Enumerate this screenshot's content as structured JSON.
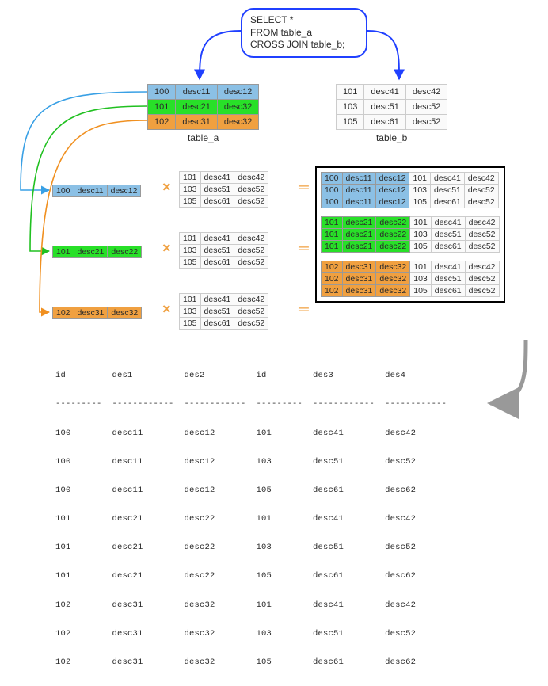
{
  "sql": {
    "line1": "SELECT *",
    "line2": "FROM table_a",
    "line3": "CROSS JOIN table_b;"
  },
  "table_a": {
    "caption": "table_a",
    "rows": [
      [
        "100",
        "desc11",
        "desc12"
      ],
      [
        "101",
        "desc21",
        "desc32"
      ],
      [
        "102",
        "desc31",
        "desc32"
      ]
    ]
  },
  "table_b": {
    "caption": "table_b",
    "rows": [
      [
        "101",
        "desc41",
        "desc42"
      ],
      [
        "103",
        "desc51",
        "desc52"
      ],
      [
        "105",
        "desc61",
        "desc52"
      ]
    ]
  },
  "source_rows": {
    "r1": [
      "100",
      "desc11",
      "desc12"
    ],
    "r2": [
      "101",
      "desc21",
      "desc22"
    ],
    "r3": [
      "102",
      "desc31",
      "desc32"
    ]
  },
  "mid_b": {
    "rows": [
      [
        "101",
        "desc41",
        "desc42"
      ],
      [
        "103",
        "desc51",
        "desc52"
      ],
      [
        "105",
        "desc61",
        "desc52"
      ]
    ]
  },
  "result": {
    "block1_left": [
      [
        "100",
        "desc11",
        "desc12"
      ],
      [
        "100",
        "desc11",
        "desc12"
      ],
      [
        "100",
        "desc11",
        "desc12"
      ]
    ],
    "block2_left": [
      [
        "101",
        "desc21",
        "desc22"
      ],
      [
        "101",
        "desc21",
        "desc22"
      ],
      [
        "101",
        "desc21",
        "desc22"
      ]
    ],
    "block3_left": [
      [
        "102",
        "desc31",
        "desc32"
      ],
      [
        "102",
        "desc31",
        "desc32"
      ],
      [
        "102",
        "desc31",
        "desc32"
      ]
    ],
    "right_rows": [
      [
        "101",
        "desc41",
        "desc42"
      ],
      [
        "103",
        "desc51",
        "desc52"
      ],
      [
        "105",
        "desc61",
        "desc52"
      ]
    ]
  },
  "symbols": {
    "times": "×",
    "eq": "═"
  },
  "output": {
    "header": "id         des1          des2          id         des3          des4",
    "sep": "---------  ------------  ------------  ---------  ------------  ------------",
    "rows": [
      "100        desc11        desc12        101        desc41        desc42",
      "100        desc11        desc12        103        desc51        desc52",
      "100        desc11        desc12        105        desc61        desc62",
      "101        desc21        desc22        101        desc41        desc42",
      "101        desc21        desc22        103        desc51        desc52",
      "101        desc21        desc22        105        desc61        desc62",
      "102        desc31        desc32        101        desc41        desc42",
      "102        desc31        desc32        103        desc51        desc52",
      "102        desc31        desc32        105        desc61        desc62"
    ]
  }
}
